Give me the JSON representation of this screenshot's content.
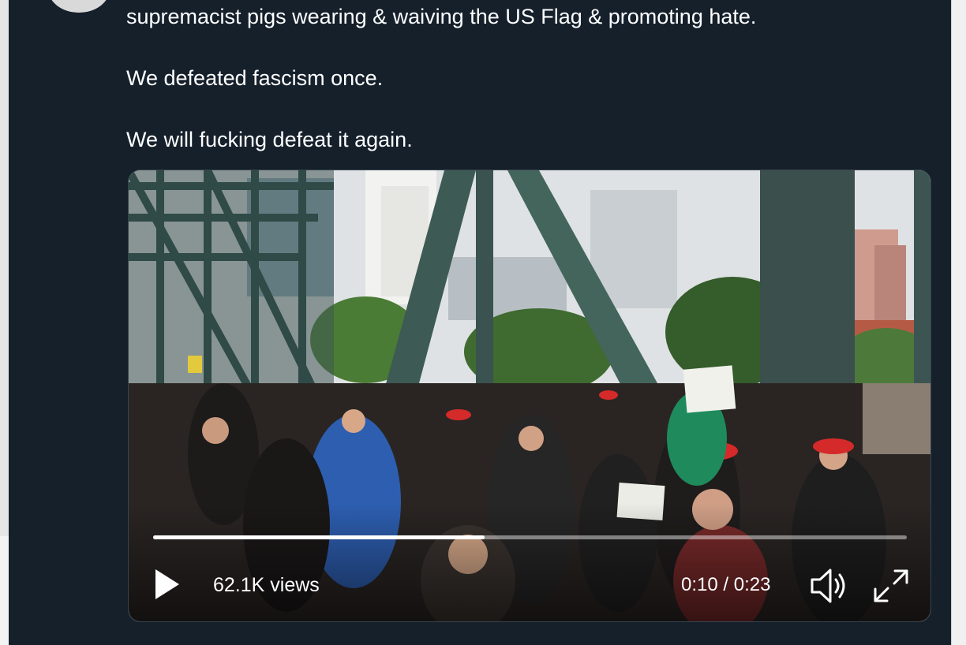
{
  "tweet": {
    "lines": [
      "supremacist pigs wearing & waiving the US Flag & promoting hate.",
      "We defeated fascism once.",
      "We will fucking defeat it again."
    ]
  },
  "video": {
    "views_label": "62.1K views",
    "time_label": "0:10 / 0:23",
    "progress": 0.44,
    "icons": {
      "play": "play-icon",
      "volume": "volume-icon",
      "fullscreen": "fullscreen-icon"
    }
  },
  "colors": {
    "background": "#15202b",
    "text": "#ffffff",
    "border": "#38444d"
  }
}
